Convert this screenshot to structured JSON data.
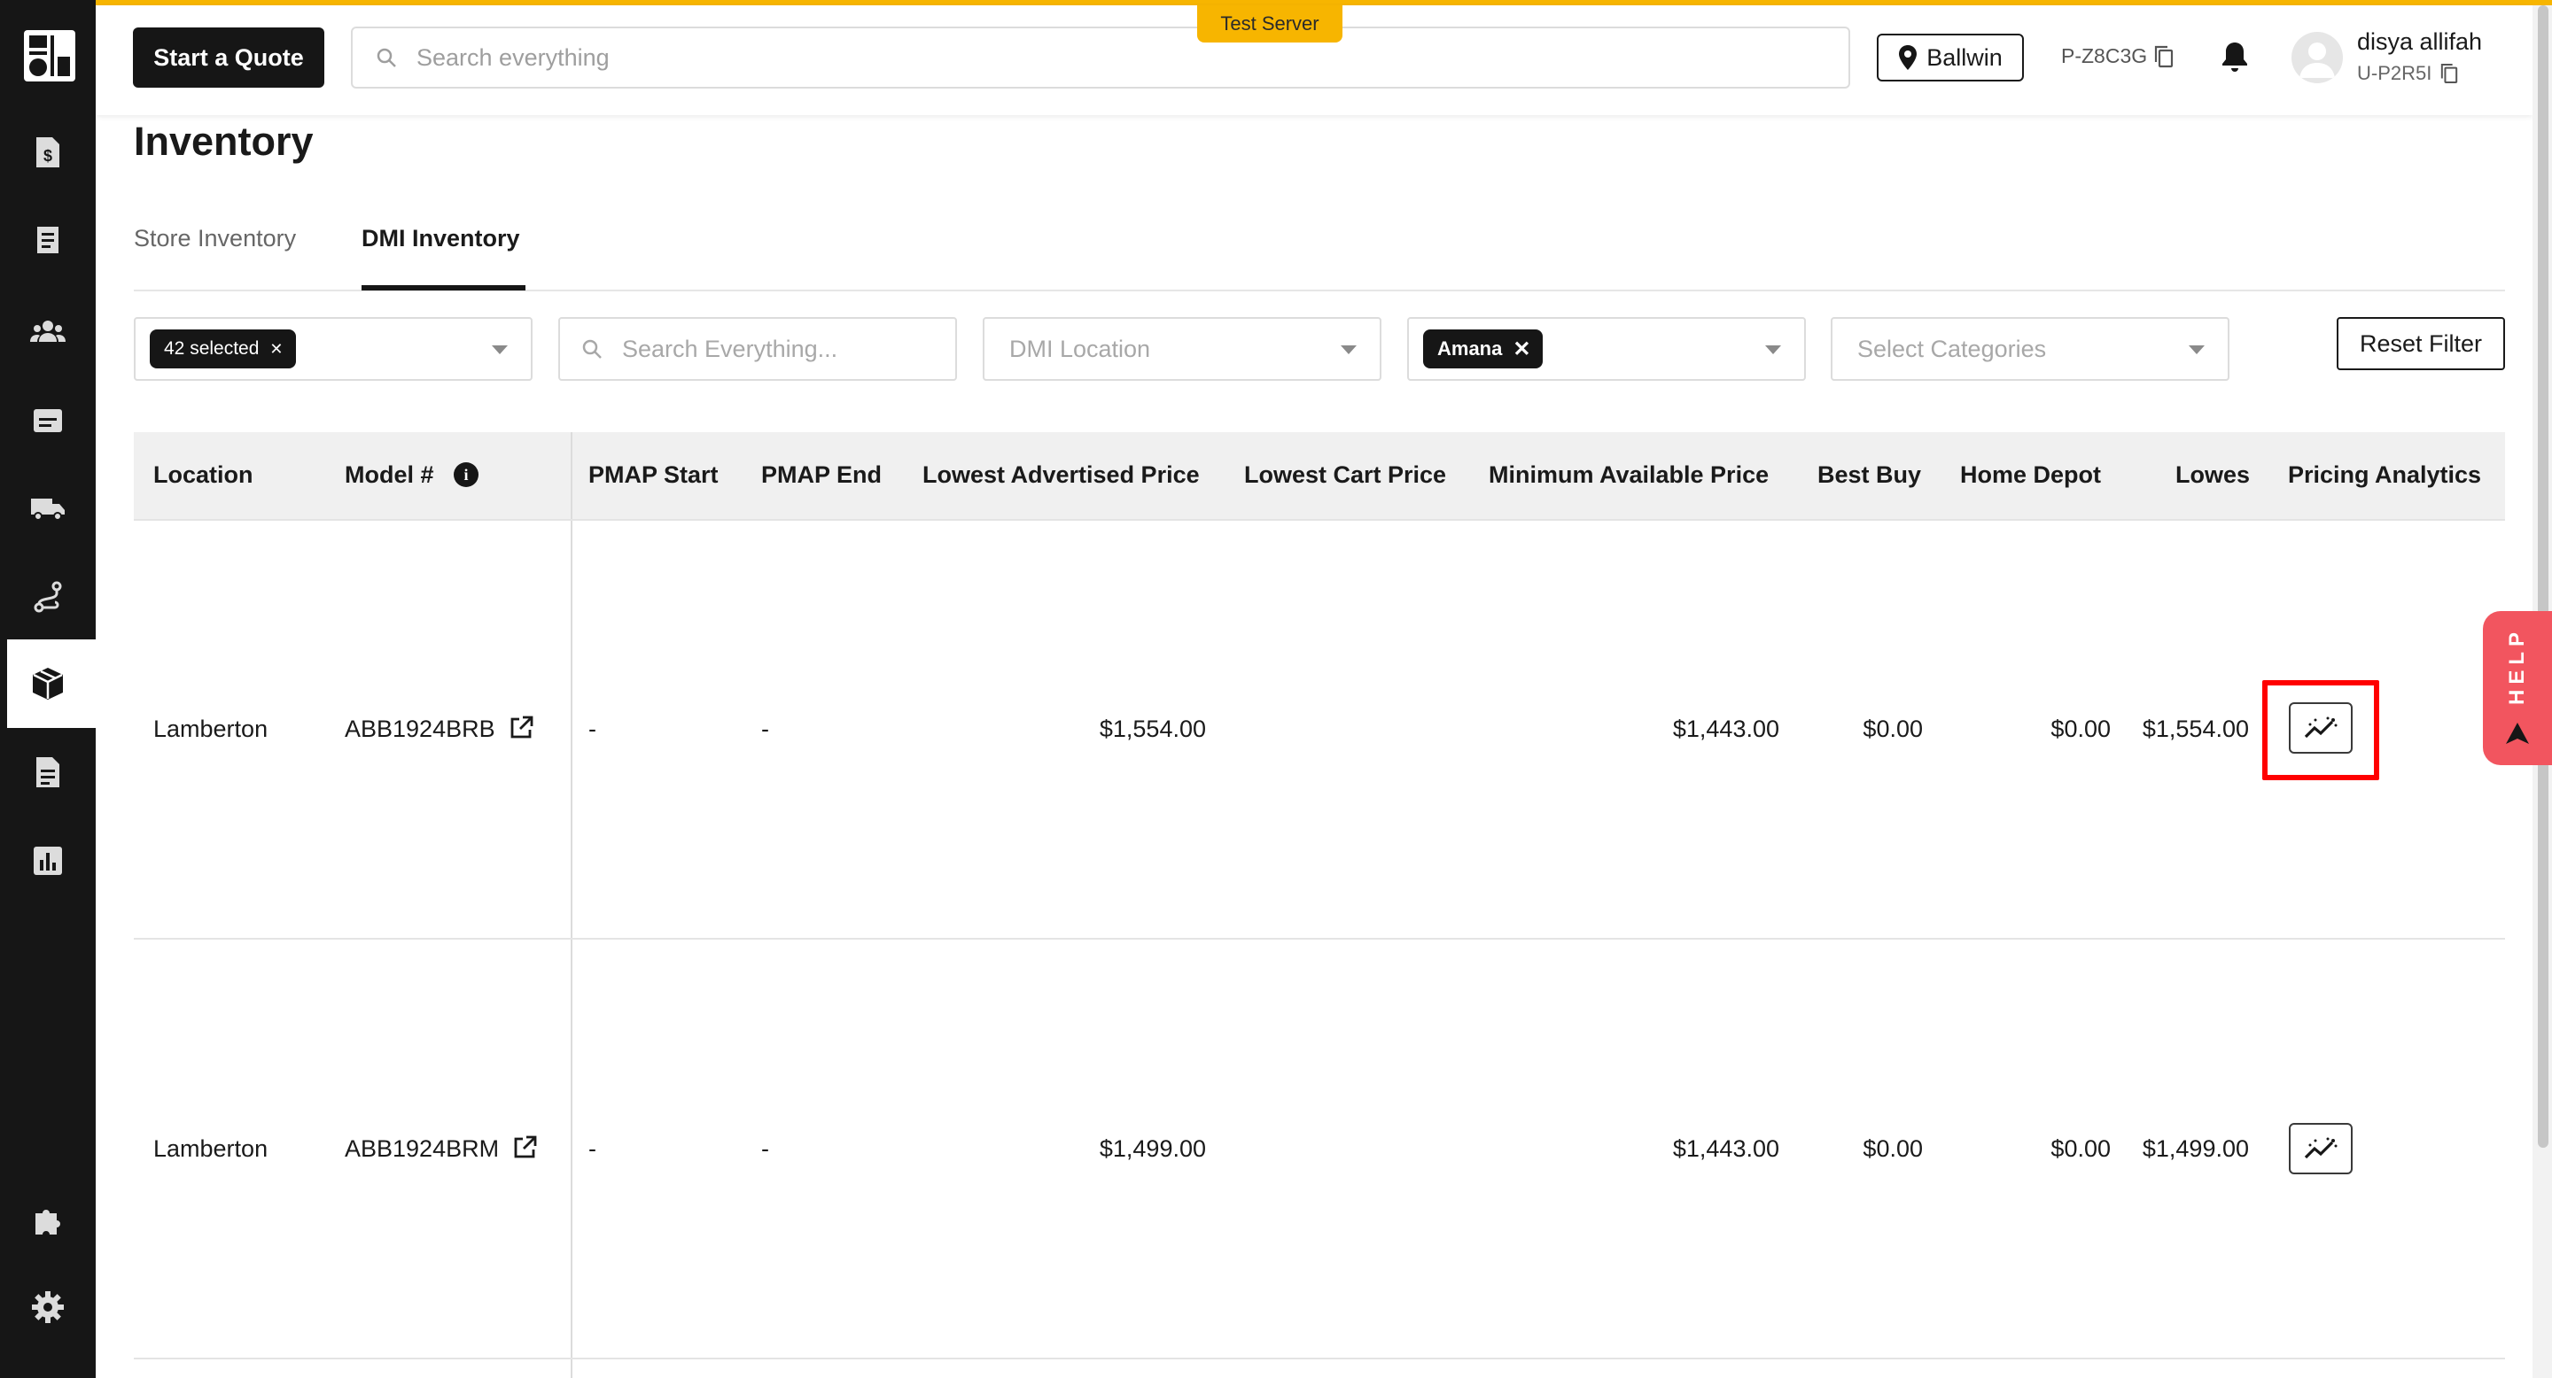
{
  "colors": {
    "accent": "#f7b500",
    "dark": "#161616",
    "highlight": "#ff0000",
    "help": "#f2555f"
  },
  "sidebar": {
    "logo": "store-logo",
    "items": [
      {
        "icon": "invoice-dollar-icon"
      },
      {
        "icon": "receipt-icon"
      },
      {
        "icon": "users-icon"
      },
      {
        "icon": "folder-icon"
      },
      {
        "icon": "truck-icon"
      },
      {
        "icon": "route-icon"
      },
      {
        "icon": "inventory-box-icon",
        "active": true
      },
      {
        "icon": "document-icon"
      },
      {
        "icon": "analytics-chart-icon"
      },
      {
        "icon": "puzzle-icon"
      },
      {
        "icon": "settings-icon"
      }
    ]
  },
  "header": {
    "quote_button": "Start a Quote",
    "search_placeholder": "Search everything",
    "server_badge": "Test Server",
    "location": "Ballwin",
    "partner_code": "P-Z8C3G",
    "user": {
      "name": "disya allifah",
      "code": "U-P2R5I"
    }
  },
  "page": {
    "title": "Inventory",
    "tabs": [
      {
        "label": "Store Inventory",
        "active": false
      },
      {
        "label": "DMI Inventory",
        "active": true
      }
    ]
  },
  "filters": {
    "stores_chip": "42 selected",
    "search_placeholder": "Search Everything...",
    "dmi_location_placeholder": "DMI Location",
    "brand_chip": "Amana",
    "categories_placeholder": "Select Categories",
    "reset_button": "Reset Filter"
  },
  "table": {
    "columns": [
      "Location",
      "Model #",
      "PMAP Start",
      "PMAP End",
      "Lowest Advertised Price",
      "Lowest Cart Price",
      "Minimum Available Price",
      "Best Buy",
      "Home Depot",
      "Lowes",
      "Pricing Analytics"
    ],
    "rows": [
      {
        "location": "Lamberton",
        "model": "ABB1924BRB",
        "pmap_start": "-",
        "pmap_end": "-",
        "lowest_advertised": "$1,554.00",
        "lowest_cart": "",
        "minimum_available": "$1,443.00",
        "best_buy": "$0.00",
        "home_depot": "$0.00",
        "lowes": "$1,554.00"
      },
      {
        "location": "Lamberton",
        "model": "ABB1924BRM",
        "pmap_start": "-",
        "pmap_end": "-",
        "lowest_advertised": "$1,499.00",
        "lowest_cart": "",
        "minimum_available": "$1,443.00",
        "best_buy": "$0.00",
        "home_depot": "$0.00",
        "lowes": "$1,499.00"
      }
    ]
  },
  "help": {
    "label": "HELP"
  }
}
